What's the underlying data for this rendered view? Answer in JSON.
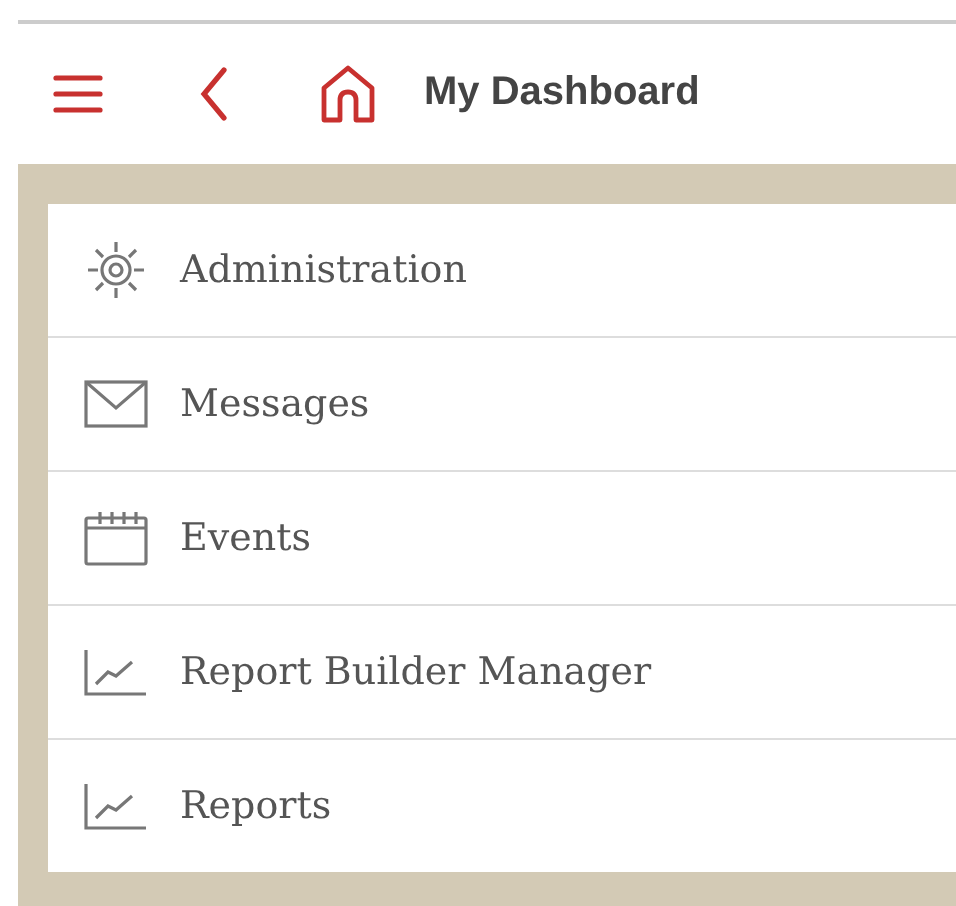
{
  "header": {
    "title": "My Dashboard"
  },
  "menu": [
    {
      "label": "Administration"
    },
    {
      "label": "Messages"
    },
    {
      "label": "Events"
    },
    {
      "label": "Report Builder Manager"
    },
    {
      "label": "Reports"
    }
  ]
}
